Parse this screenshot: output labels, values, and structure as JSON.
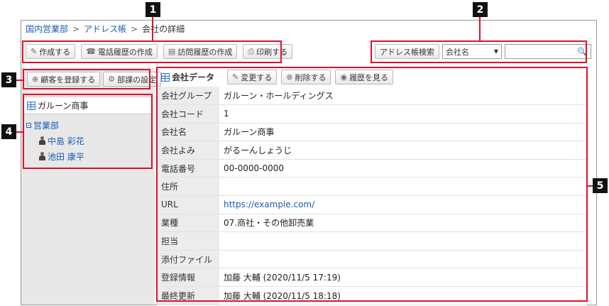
{
  "breadcrumb": {
    "items": [
      "国内営業部",
      "アドレス帳"
    ],
    "current": "会社の詳細",
    "separator": ">"
  },
  "toolbar": {
    "create": "作成する",
    "phone_history": "電話履歴の作成",
    "visit_history": "訪問履歴の作成",
    "print": "印刷する"
  },
  "search": {
    "button": "アドレス帳検索",
    "select_value": "会社名",
    "input_value": ""
  },
  "subbar": {
    "register_customer": "顧客を登録する",
    "dept_settings": "部課の設定"
  },
  "tree": {
    "company": "ガルーン商事",
    "department": "営業部",
    "members": [
      "中島 彩花",
      "池田 康平"
    ]
  },
  "main": {
    "title": "会社データ",
    "edit": "変更する",
    "delete": "削除する",
    "history": "履歴を見る"
  },
  "fields": [
    {
      "label": "会社グループ",
      "value": "ガルーン・ホールディングス"
    },
    {
      "label": "会社コード",
      "value": "1"
    },
    {
      "label": "会社名",
      "value": "ガルーン商事"
    },
    {
      "label": "会社よみ",
      "value": "がるーんしょうじ"
    },
    {
      "label": "電話番号",
      "value": "00-0000-0000"
    },
    {
      "label": "住所",
      "value": ""
    },
    {
      "label": "URL",
      "value": "https://example.com/"
    },
    {
      "label": "業種",
      "value": "07.商社・その他卸売業"
    },
    {
      "label": "担当",
      "value": ""
    },
    {
      "label": "添付ファイル",
      "value": ""
    },
    {
      "label": "登録情報",
      "value": "加藤 大輔 (2020/11/5 17:19)"
    },
    {
      "label": "最終更新",
      "value": "加藤 大輔 (2020/11/5 18:18)"
    }
  ],
  "callouts": [
    "1",
    "2",
    "3",
    "4",
    "5"
  ],
  "colors": {
    "callout": "#e0112b",
    "link": "#1a5db0"
  }
}
